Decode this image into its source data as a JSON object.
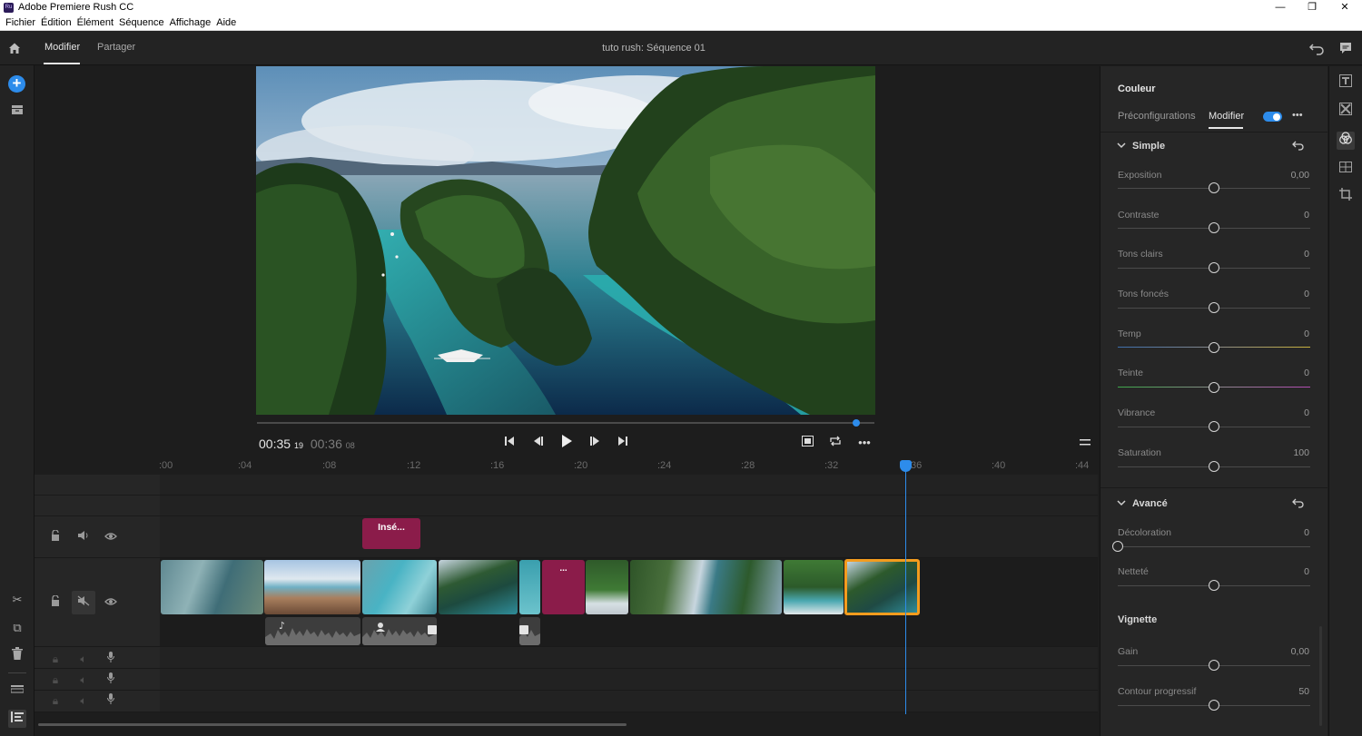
{
  "window": {
    "title": "Adobe Premiere Rush CC",
    "app_icon_text": "Ru",
    "minimize": "—",
    "maximize": "❐",
    "close": "✕"
  },
  "menu": [
    "Fichier",
    "Édition",
    "Élément",
    "Séquence",
    "Affichage",
    "Aide"
  ],
  "header": {
    "tabs": [
      "Modifier",
      "Partager"
    ],
    "active_tab": "Modifier",
    "sequence_title": "tuto rush: Séquence  01"
  },
  "playback": {
    "current": "00:35",
    "current_frames": "19",
    "duration": "00:36",
    "duration_frames": "08",
    "progress": 0.97
  },
  "ruler": [
    ":00",
    ":04",
    ":08",
    ":12",
    ":16",
    ":20",
    ":24",
    ":28",
    ":32",
    ":36",
    ":40",
    ":44"
  ],
  "timeline": {
    "title_clip_label": "Insé...",
    "gap_clip_label": "..."
  },
  "panel": {
    "title": "Couleur",
    "tabs": [
      "Préconfigurations",
      "Modifier"
    ],
    "active_tab": "Modifier",
    "toggle_on": true,
    "more": "•••",
    "sections": [
      {
        "name": "Simple",
        "controls": [
          {
            "label": "Exposition",
            "value": "0,00",
            "level": 0.5
          },
          {
            "label": "Contraste",
            "value": "0",
            "level": 0.5
          },
          {
            "label": "Tons clairs",
            "value": "0",
            "level": 0.5
          },
          {
            "label": "Tons foncés",
            "value": "0",
            "level": 0.5
          },
          {
            "label": "Temp",
            "value": "0",
            "level": 0.5
          },
          {
            "label": "Teinte",
            "value": "0",
            "level": 0.5
          },
          {
            "label": "Vibrance",
            "value": "0",
            "level": 0.5
          },
          {
            "label": "Saturation",
            "value": "100",
            "level": 0.5
          }
        ]
      },
      {
        "name": "Avancé",
        "controls": [
          {
            "label": "Décoloration",
            "value": "0",
            "level": 0.0
          },
          {
            "label": "Netteté",
            "value": "0",
            "level": 0.5
          }
        ]
      },
      {
        "name": "Vignette",
        "controls": [
          {
            "label": "Gain",
            "value": "0,00",
            "level": 0.5
          },
          {
            "label": "Contour progressif",
            "value": "50",
            "level": 0.5
          }
        ]
      }
    ]
  },
  "colors": {
    "accent": "#2d8ceb",
    "title_clip": "#8b1c4a",
    "selected_clip": "#f39c1e",
    "panel_bg": "#262626"
  }
}
